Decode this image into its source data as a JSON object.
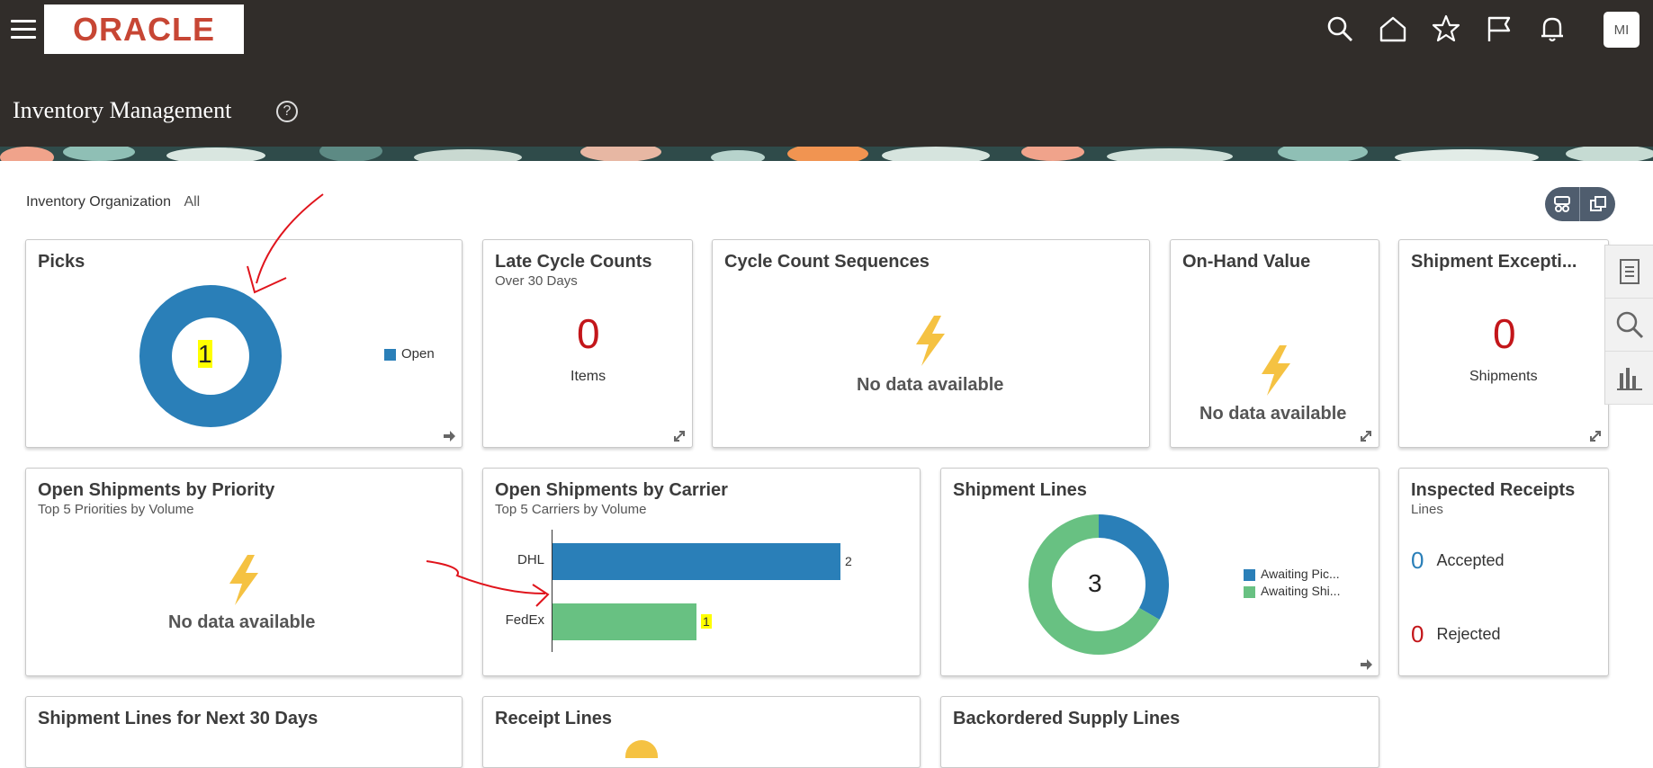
{
  "header": {
    "logo_text": "ORACLE",
    "page_title": "Inventory Management",
    "avatar_initials": "MI",
    "icons": [
      "search-icon",
      "home-icon",
      "star-icon",
      "flag-icon",
      "bell-icon"
    ]
  },
  "filter": {
    "label": "Inventory Organization",
    "value": "All"
  },
  "colors": {
    "blue": "#2a7fb8",
    "green": "#68c182",
    "red": "#c3161a",
    "bolt": "#f5c242"
  },
  "cards": {
    "picks": {
      "title": "Picks",
      "center": "1",
      "legend": "Open"
    },
    "late_cycle": {
      "title": "Late Cycle Counts",
      "subtitle": "Over 30 Days",
      "value": "0",
      "unit": "Items"
    },
    "cycle_seq": {
      "title": "Cycle Count Sequences",
      "nodata": "No data available"
    },
    "onhand": {
      "title": "On-Hand Value",
      "nodata": "No data available"
    },
    "ship_exc": {
      "title": "Shipment Excepti...",
      "value": "0",
      "unit": "Shipments"
    },
    "open_priority": {
      "title": "Open Shipments by Priority",
      "subtitle": "Top 5 Priorities by Volume",
      "nodata": "No data available"
    },
    "open_carrier": {
      "title": "Open Shipments by Carrier",
      "subtitle": "Top 5 Carriers by Volume"
    },
    "ship_lines": {
      "title": "Shipment Lines",
      "center": "3",
      "legend": [
        "Awaiting Pic...",
        "Awaiting Shi..."
      ]
    },
    "inspected": {
      "title": "Inspected Receipts",
      "subtitle": "Lines",
      "accepted_num": "0",
      "accepted": "Accepted",
      "rejected_num": "0",
      "rejected": "Rejected"
    },
    "ship_next": {
      "title": "Shipment Lines for Next 30 Days"
    },
    "receipt": {
      "title": "Receipt Lines"
    },
    "backorder": {
      "title": "Backordered Supply Lines"
    }
  },
  "chart_data": [
    {
      "type": "pie",
      "title": "Picks",
      "categories": [
        "Open"
      ],
      "values": [
        1
      ],
      "donut": true
    },
    {
      "type": "bar",
      "title": "Open Shipments by Carrier",
      "categories": [
        "DHL",
        "FedEx"
      ],
      "values": [
        2,
        1
      ],
      "orientation": "horizontal"
    },
    {
      "type": "pie",
      "title": "Shipment Lines",
      "categories": [
        "Awaiting Pic...",
        "Awaiting Shi..."
      ],
      "values": [
        1,
        2
      ],
      "donut": true
    }
  ]
}
